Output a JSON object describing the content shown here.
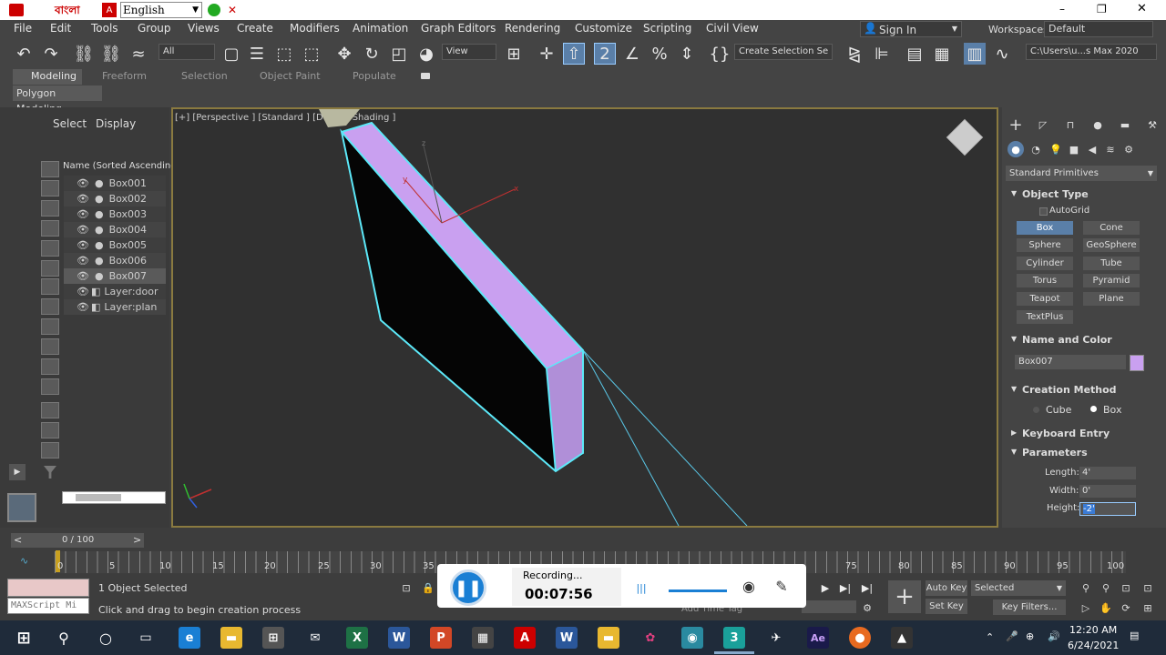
{
  "titlebar": {
    "bangla_label": "বাংলা",
    "lang_value": "English",
    "minimize": "–",
    "restore": "❐",
    "close": "✕"
  },
  "menus": [
    "File",
    "Edit",
    "Tools",
    "Group",
    "Views",
    "Create",
    "Modifiers",
    "Animation",
    "Graph Editors",
    "Rendering",
    "Customize",
    "Scripting",
    "Civil View"
  ],
  "signin": "Sign In",
  "workspaces_label": "Workspaces:",
  "workspace_value": "Default",
  "toolbar": {
    "filter": "All",
    "view": "View",
    "selection_set": "Create Selection Se",
    "path": "C:\\Users\\u...s Max 2020"
  },
  "ribbon_tabs": [
    "Modeling",
    "Freeform",
    "Selection",
    "Object Paint",
    "Populate"
  ],
  "ribbon_sub": "Polygon Modeling",
  "explorer": {
    "select_tab": "Select",
    "display_tab": "Display",
    "column": "Name (Sorted Ascending)",
    "items": [
      "Box001",
      "Box002",
      "Box003",
      "Box004",
      "Box005",
      "Box006",
      "Box007",
      "Layer:door",
      "Layer:plan"
    ]
  },
  "viewport": {
    "label": "[+] [Perspective ] [Standard ] [Default Shading ]",
    "axis_x": "x",
    "axis_y": "y",
    "axis_z": "z"
  },
  "cmd": {
    "category": "Standard Primitives",
    "object_type": "Object Type",
    "autogrid": "AutoGrid",
    "buttons": [
      "Box",
      "Cone",
      "Sphere",
      "GeoSphere",
      "Cylinder",
      "Tube",
      "Torus",
      "Pyramid",
      "Teapot",
      "Plane",
      "TextPlus"
    ],
    "name_color": "Name and Color",
    "object_name": "Box007",
    "object_color": "#c9a0f0",
    "creation_method": "Creation Method",
    "cube": "Cube",
    "box": "Box",
    "keyboard_entry": "Keyboard Entry",
    "parameters": "Parameters",
    "length_label": "Length:",
    "length_value": "4'",
    "width_label": "Width:",
    "width_value": "0'",
    "height_label": "Height:",
    "height_value": "-2'"
  },
  "timeline": {
    "frame": "0 / 100",
    "ticks": [
      "0",
      "5",
      "10",
      "15",
      "20",
      "25",
      "30",
      "35",
      "75",
      "80",
      "85",
      "90",
      "95",
      "100"
    ]
  },
  "status": {
    "maxscript": "MAXScript Mi",
    "selected": "1 Object Selected",
    "prompt": "Click and drag to begin creation process",
    "add_time_tag": "Add Time Tag",
    "auto_key": "Auto Key",
    "set_key": "Set Key",
    "selected_dd": "Selected",
    "key_filters": "Key Filters..."
  },
  "recording": {
    "label": "Recording...",
    "time": "00:07:56"
  },
  "clock": {
    "time": "12:20 AM",
    "date": "6/24/2021"
  }
}
